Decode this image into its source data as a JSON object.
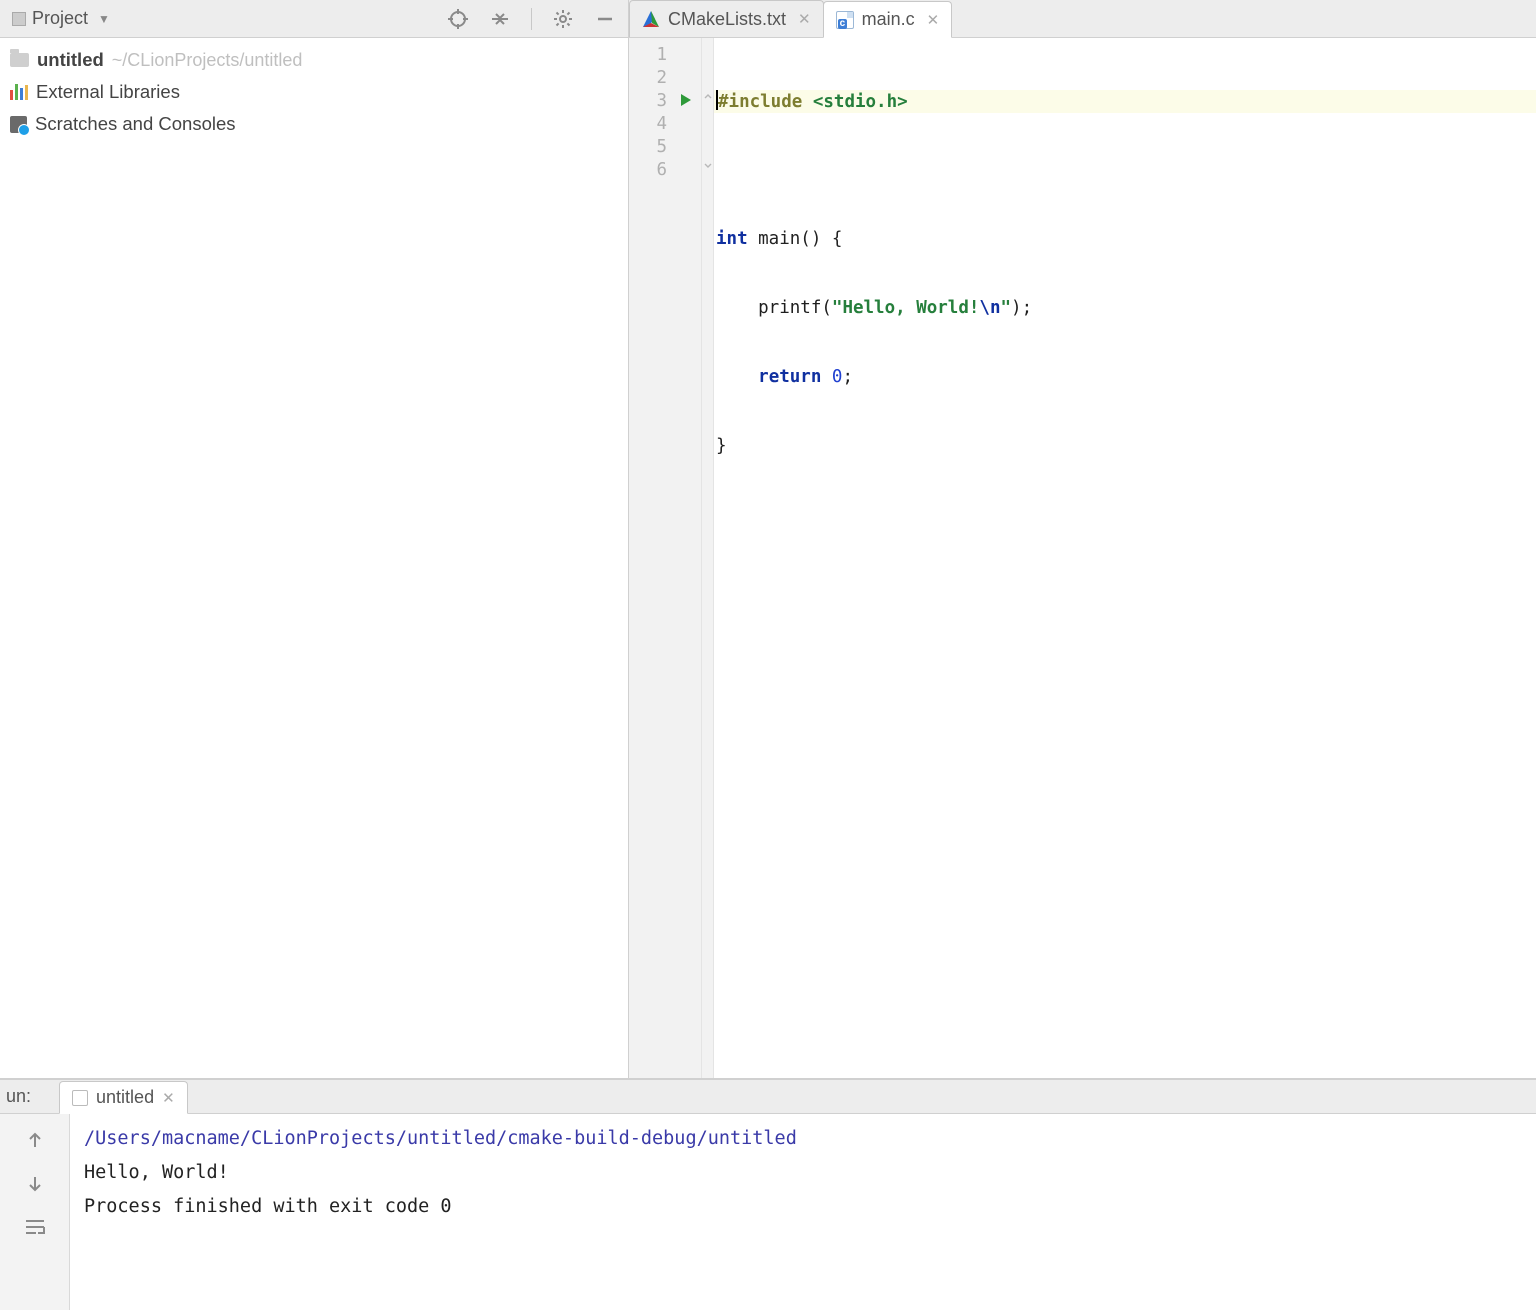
{
  "sidebar": {
    "title": "Project",
    "tree": {
      "project_name": "untitled",
      "project_path": "~/CLionProjects/untitled",
      "external_libs": "External Libraries",
      "scratches": "Scratches and Consoles"
    }
  },
  "tabs": {
    "cmake": "CMakeLists.txt",
    "main": "main.c"
  },
  "code": {
    "lines": [
      "1",
      "2",
      "3",
      "4",
      "5",
      "6"
    ],
    "l1_pre": "#include",
    "l1_hdr": "<stdio.h>",
    "l3_kw": "int",
    "l3_rest": " main() {",
    "l4_indent": "    printf(",
    "l4_str1": "\"Hello, World!",
    "l4_esc": "\\n",
    "l4_str2": "\"",
    "l4_end": ");",
    "l5_indent": "    ",
    "l5_kw": "return",
    "l5_num": " 0",
    "l5_end": ";",
    "l6": "}"
  },
  "run": {
    "label": "un:",
    "config": "untitled",
    "path": "/Users/macname/CLionProjects/untitled/cmake-build-debug/untitled",
    "output": "Hello, World!",
    "blank": "",
    "exit": "Process finished with exit code 0"
  }
}
